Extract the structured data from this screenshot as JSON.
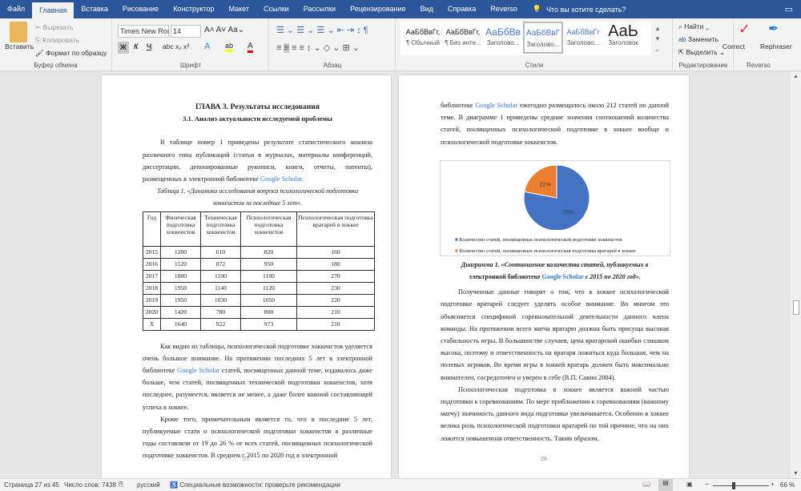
{
  "tabs": [
    "Файл",
    "Главная",
    "Вставка",
    "Рисование",
    "Конструктор",
    "Макет",
    "Ссылки",
    "Рассылки",
    "Рецензирование",
    "Вид",
    "Справка",
    "Reverso"
  ],
  "tell_me": "Что вы хотите сделать?",
  "clipboard": {
    "paste": "Вставить",
    "cut": "Вырезать",
    "copy": "Копировать",
    "format_painter": "Формат по образцу",
    "label": "Буфер обмена"
  },
  "font": {
    "name": "Times New Roı",
    "size": "14",
    "bold": "Ж",
    "italic": "К",
    "underline": "Ч",
    "label": "Шрифт"
  },
  "paragraph": {
    "label": "Абзац"
  },
  "styles": {
    "label": "Стили",
    "items": [
      {
        "sample": "АаБбВвГг,",
        "name": "¶ Обычный"
      },
      {
        "sample": "АаБбВвГг,",
        "name": "¶ Без инте..."
      },
      {
        "sample": "АаБбВв",
        "name": "Заголово..."
      },
      {
        "sample": "АаБбВвГ",
        "name": "Заголово..."
      },
      {
        "sample": "АаБбВвГг",
        "name": "Заголово..."
      },
      {
        "sample": "АаЬ",
        "name": "Заголовок"
      }
    ]
  },
  "editing": {
    "find": "Найти",
    "replace": "Заменить",
    "select": "Выделить",
    "label": "Редактирование"
  },
  "reverso": {
    "correct": "Correct",
    "rephraser": "Rephraser",
    "label": "Reverso"
  },
  "page27": {
    "chapter": "ГЛАВА 3. Результаты исследования",
    "section": "3.1. Анализ актуальности исследуемой проблемы",
    "p1": "В таблице номер 1 приведены результате статистического анализа различного типа публикаций (статьи в журналах, материалы конференций, диссертации, депонированные рукописи, книги, отчеты, патенты), размещенных в электронной библиотеке ",
    "link": "Google Scholar",
    "p1_end": ".",
    "table_caption": "Таблица 1. «Динамика исследования вопроса психологической подготовки хоккеистов за последние 5 лет».",
    "table": {
      "headers": [
        "Год",
        "Физическая подготовка хоккеистов",
        "Техническая подготовка хоккеистов",
        "Психологическая подготовка хоккеистов",
        "Психологическая подготовка вратарей в хоккее"
      ],
      "rows": [
        [
          "2015",
          "1200",
          "610",
          "820",
          "160"
        ],
        [
          "2016",
          "1520",
          "872",
          "950",
          "180"
        ],
        [
          "2017",
          "1800",
          "1100",
          "1100",
          "270"
        ],
        [
          "2018",
          "1950",
          "1140",
          "1120",
          "230"
        ],
        [
          "2019",
          "1950",
          "1030",
          "1050",
          "220"
        ],
        [
          "2020",
          "1420",
          "780",
          "800",
          "210"
        ],
        [
          "X",
          "1640",
          "922",
          "973",
          "210"
        ]
      ]
    },
    "p2a": "Как видно из таблицы, психологической подготовке хоккеистов уделяется очень большое внимание. На протяжении последних 5 лет в электронной библиотеке ",
    "p2b": "  статей, посвященных данной теме, издавалось даже больше, чем статей, посвященных технической подготовки хоккеистов, хотя последнее, разумеется, является не менее, а даже более важной составляющей успеха в хоккее.",
    "p3": "Кроме того, примечательным является то, что в последние 5 лет, публикуемые стати о психологической подготовки хоккеистов в различные годы составляли от 19 до 26 % от всех статей, посвященных психологической подготовке хоккеистов. В среднем с 2015 по 2020 год в электронной",
    "page_number": "27"
  },
  "page28": {
    "p1a": "библиотеке ",
    "p1b": "  ежегодно размещалось около 212 статей по данной теме. В диаграмме 1 приведены средние значения соотношений количества статей, посвященных психологической подготовке в хоккее вообще и психологической подготовке хоккеистов.",
    "caption_a": "Диаграмма 1. «Соотношение количества статей, публикуемых в",
    "caption_b": "электронной библиотеке ",
    "caption_c": "  с 2015 по 2020 год».",
    "p2": "Полученные данные говорят о том, что в хоккее психологической подготовке вратарей следует уделять особое внимание. Во многом это объясняется спецификой соревновательной деятельности данного члена команды. На протяжении всего матча вратарю должна быть присуща высокая стабильность игры. В большинстве случаев, цена вратарской ошибки слишком высока, поэтому и ответственность на вратаря ложиться куда большая, чем на полевых игроков. Во время игры в хоккей вратарь должен быть максимально внимателен, сосредоточен и уверен в себе (В.П. Савин 2004).",
    "p3": "Психологическая подготовка в хоккее является важной частью подготовки к соревнованиям. По мере приближения к соревнованиям (важному матчу) значимость данного вида подготовки увеличивается. Особенно в хоккее велика роль психологической подготовки вратарей по той причине, что на них ложится повышенная ответственность.  Таким образом,",
    "page_number": "28"
  },
  "chart_data": {
    "type": "pie",
    "title": "",
    "labels": [
      "Количество статей, посвященных психологической подготовке хоккеистов",
      "Количество статей, посвященных психологическая подготовка вратарей в хоккее"
    ],
    "values": [
      78,
      22
    ],
    "data_labels": [
      "78%",
      "22%"
    ],
    "colors": [
      "#4472c4",
      "#ed7d31"
    ],
    "legend": "bottom"
  },
  "status": {
    "page": "Страница 27 из 45",
    "words": "Число слов: 7438",
    "lang": "русский",
    "accessibility": "Специальные возможности: проверьте рекомендации",
    "zoom": "66 %",
    "zoom_level": 66
  }
}
